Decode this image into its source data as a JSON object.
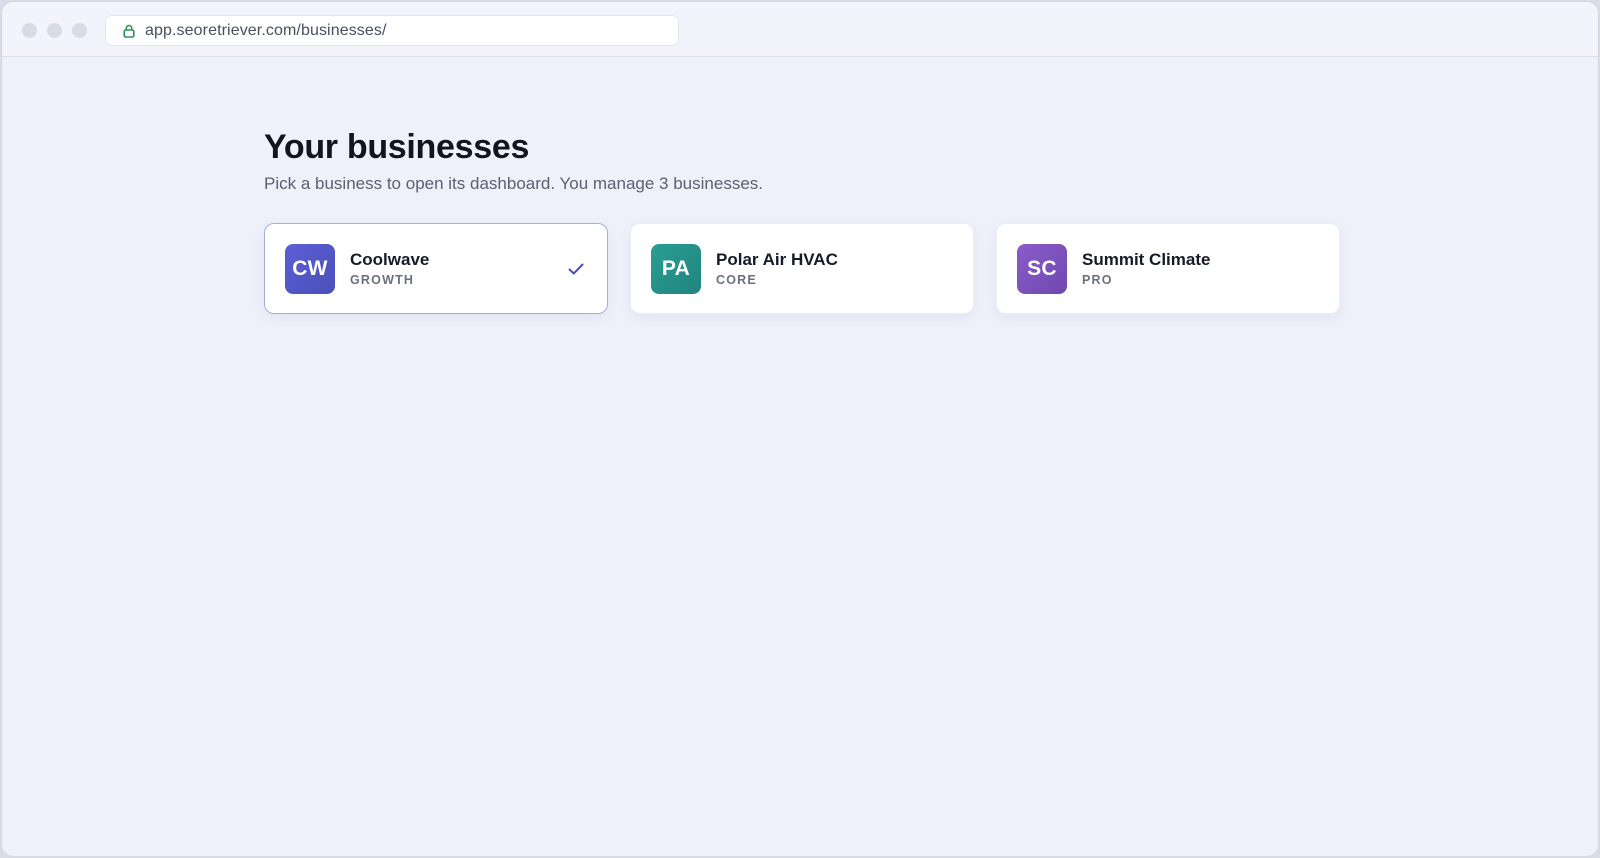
{
  "browser": {
    "url": "app.seoretriever.com/businesses/",
    "lock_icon": "lock-icon"
  },
  "page": {
    "title": "Your businesses",
    "subtitle": "Pick a business to open its dashboard. You manage 3 businesses."
  },
  "businesses": [
    {
      "initials": "CW",
      "name": "Coolwave",
      "plan": "GROWTH",
      "selected": true,
      "avatar_colors": [
        "#5b5fd6",
        "#4a4fb8"
      ]
    },
    {
      "initials": "PA",
      "name": "Polar Air HVAC",
      "plan": "CORE",
      "selected": false,
      "avatar_colors": [
        "#2b9d94",
        "#1f857e"
      ]
    },
    {
      "initials": "SC",
      "name": "Summit Climate",
      "plan": "PRO",
      "selected": false,
      "avatar_colors": [
        "#8a5cc9",
        "#6f48b0"
      ]
    }
  ],
  "colors": {
    "check": "#4a4fb8",
    "lock": "#2f8f5a"
  }
}
